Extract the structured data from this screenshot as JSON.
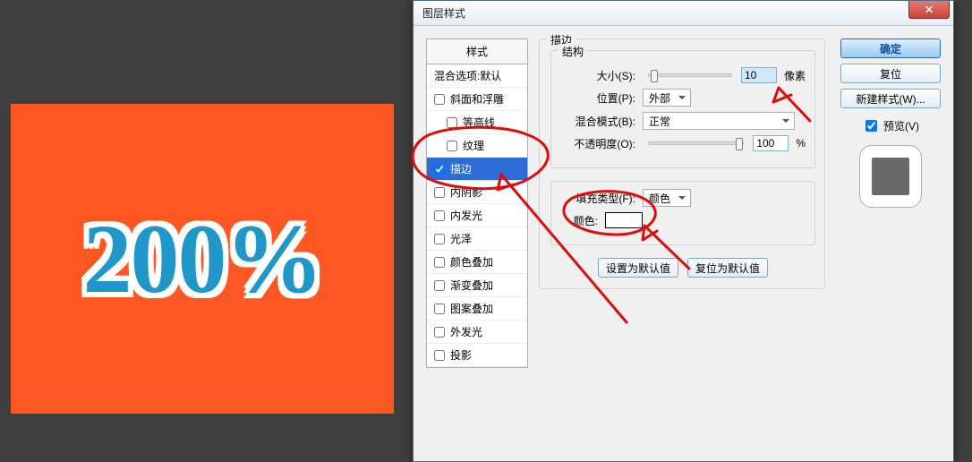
{
  "canvas": {
    "text": "200%"
  },
  "dialog": {
    "title": "图层样式"
  },
  "styles": {
    "header": "样式",
    "blend_defaults": "混合选项:默认",
    "bevel": "斜面和浮雕",
    "contour": "等高线",
    "texture": "纹理",
    "stroke": "描边",
    "inner_shadow": "内阴影",
    "inner_glow": "内发光",
    "satin": "光泽",
    "color_overlay": "颜色叠加",
    "gradient_overlay": "渐变叠加",
    "pattern_overlay": "图案叠加",
    "outer_glow": "外发光",
    "drop_shadow": "投影"
  },
  "stroke": {
    "panel_title": "描边",
    "structure_title": "结构",
    "size_label": "大小(S):",
    "size_value": "10",
    "size_unit": "像素",
    "position_label": "位置(P):",
    "position_value": "外部",
    "blend_mode_label": "混合模式(B):",
    "blend_mode_value": "正常",
    "opacity_label": "不透明度(O):",
    "opacity_value": "100",
    "opacity_unit": "%",
    "fill_type_label": "填充类型(F):",
    "fill_type_value": "颜色",
    "color_label": "颜色:",
    "color_value": "#ffffff",
    "make_default": "设置为默认值",
    "reset_default": "复位为默认值"
  },
  "side": {
    "ok": "确定",
    "reset": "复位",
    "new_style": "新建样式(W)...",
    "preview_label": "预览(V)"
  }
}
